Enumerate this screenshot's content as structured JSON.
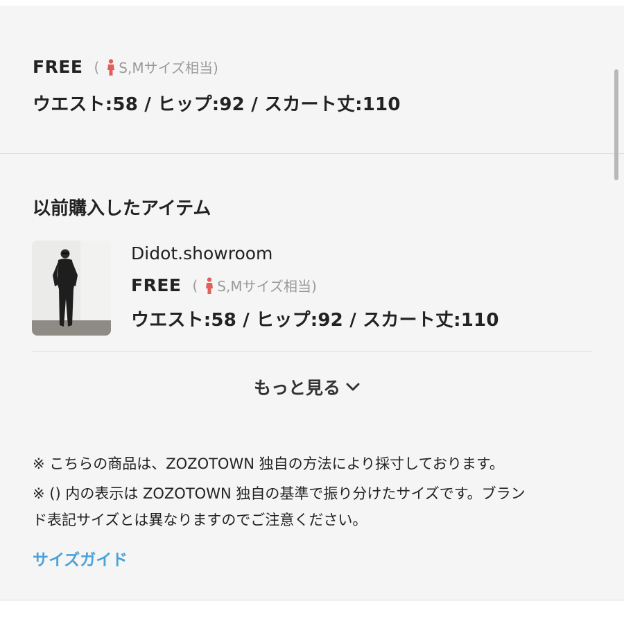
{
  "current_size": {
    "name": "FREE",
    "hint_open": "(",
    "hint_text": "S,Mサイズ相当)",
    "measurements": "ウエスト:58 / ヒップ:92 / スカート丈:110"
  },
  "previous_items": {
    "title": "以前購入したアイテム",
    "items": [
      {
        "brand": "Didot.showroom",
        "size_name": "FREE",
        "hint_open": "(",
        "hint_text": "S,Mサイズ相当)",
        "measurements": "ウエスト:58 / ヒップ:92 / スカート丈:110"
      }
    ],
    "more_label": "もっと見る"
  },
  "notes": [
    "※ こちらの商品は、ZOZOTOWN 独自の方法により採寸しております。",
    "※ () 内の表示は ZOZOTOWN 独自の基準で振り分けたサイズです。ブラン",
    "ド表記サイズとは異なりますのでご注意ください。"
  ],
  "size_guide_label": "サイズガイド",
  "colors": {
    "background": "#f5f5f5",
    "text": "#222222",
    "hint": "#9a9a9a",
    "person_icon": "#e0605c",
    "link": "#4aa3d8",
    "divider": "#dedede"
  },
  "icons": {
    "person": "person-icon",
    "chevron": "chevron-down-icon"
  }
}
